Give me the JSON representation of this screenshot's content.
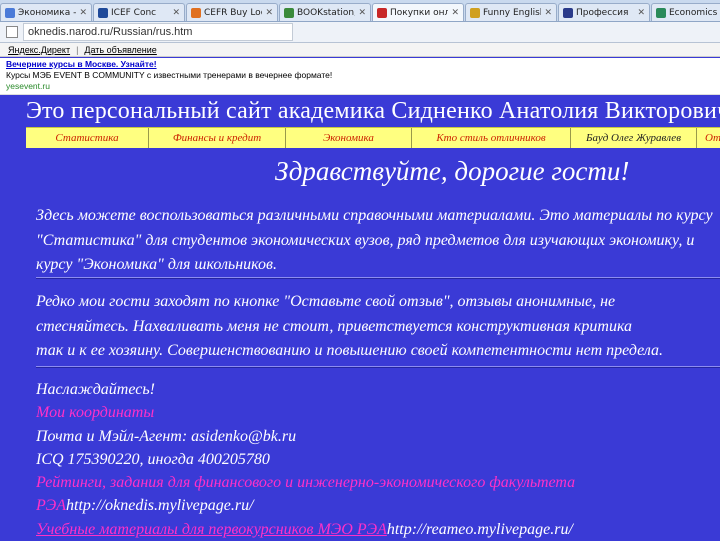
{
  "browser": {
    "tabs": [
      {
        "label": "Экономика - Мульти",
        "close": "✕",
        "favicon_color": "#4b7bd8"
      },
      {
        "label": "ICEF Conc",
        "close": "✕",
        "favicon_color": "#1f4a9a"
      },
      {
        "label": "CEFR Buy Locat",
        "close": "✕",
        "favicon_color": "#e07020"
      },
      {
        "label": "BOOKstation, No",
        "close": "✕",
        "favicon_color": "#3a8a3a"
      },
      {
        "label": "Покупки онлайн",
        "close": "✕",
        "favicon_color": "#c82828"
      },
      {
        "label": "Funny English",
        "close": "✕",
        "favicon_color": "#d0a020"
      },
      {
        "label": "Профессия",
        "close": "✕",
        "favicon_color": "#2a3a8a"
      },
      {
        "label": "Economics",
        "close": "✕",
        "favicon_color": "#2a8a5a"
      }
    ],
    "url": "oknedis.narod.ru/Russian/rus.htm",
    "toolbar": {
      "item1": "Яндекс.Директ",
      "item2": "Дать объявление"
    },
    "ad": {
      "title": "Вечерние курсы в Москве. Узнайте!",
      "text": "Курсы МЭБ EVENT В COMMUNITY с известными тренерами в вечернее формате!",
      "url": "yesevent.ru"
    }
  },
  "page": {
    "title": "Это персональный сайт академика Сидненко Анатолия Викторовича",
    "nav": [
      "Статистика",
      "Финансы и кредит",
      "Экономика",
      "Кто стиль отличников",
      "Бауд Олег Журавлев",
      "Отзывы"
    ],
    "greeting": "Здравствуйте, дорогие гости!",
    "paragraph1": [
      "Здесь можете воспользоваться различными справочными материалами. Это материалы по курсу",
      "\"Статистика\" для студентов экономических вузов, ряд предметов для изучающих экономику, и",
      "курсу \"Экономика\" для школьников."
    ],
    "paragraph2": [
      "Редко мои гости заходят по кнопке \"Оставьте свой отзыв\", отзывы анонимные, не",
      "стесняйтесь. Нахваливать меня не стоит, приветствуется конструктивная критика",
      "так и к ее хозяину. Совершенствованию и повышению своей компетентности нет предела."
    ],
    "enjoy": "Наслаждайтесь!",
    "coords_link": "Мои координаты",
    "mail": "Почта и Мэйл-Агент: asidenko@bk.ru",
    "icq": "ICQ 175390220, иногда 400205780",
    "ratings_line": "Рейтинги, задания для финансового и инженерно-экономического факультета",
    "rea_prefix": "РЭА",
    "rea_url": "http://oknedis.mylivepage.ru/",
    "materials_link": "Учебные материалы для первокурсников МЭО РЭА",
    "materials_url": "http://reameo.mylivepage.ru/"
  },
  "colors": {
    "background": "#3a3ad6",
    "nav_background": "#ffff80",
    "nav_text": "#cc2200",
    "link_pink": "#ff30c8",
    "text": "#ffffff"
  }
}
